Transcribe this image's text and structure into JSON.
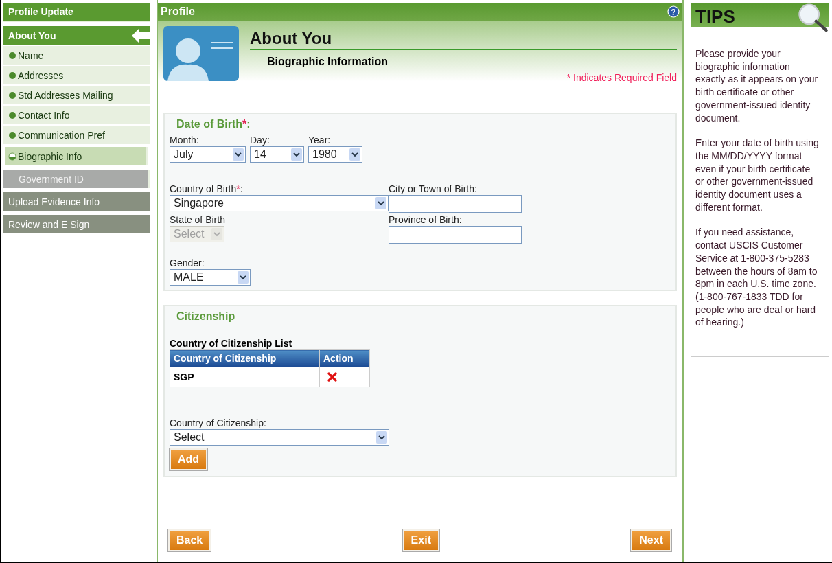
{
  "sidebar": {
    "title": "Profile Update",
    "sections": [
      {
        "label": "About You",
        "selected": true,
        "children": [
          {
            "label": "Name",
            "selected": false,
            "disabled": false
          },
          {
            "label": "Addresses",
            "selected": false,
            "disabled": false
          },
          {
            "label": "Std Addresses Mailing",
            "selected": false,
            "disabled": false
          },
          {
            "label": "Contact Info",
            "selected": false,
            "disabled": false
          },
          {
            "label": "Communication Pref",
            "selected": false,
            "disabled": false
          },
          {
            "label": "Biographic Info",
            "selected": true,
            "disabled": false
          },
          {
            "label": "Government ID",
            "selected": false,
            "disabled": true
          }
        ]
      },
      {
        "label": "Upload Evidence Info",
        "selected": false
      },
      {
        "label": "Review and E Sign",
        "selected": false
      }
    ]
  },
  "panel": {
    "title": "Profile",
    "help_glyph": "?",
    "heading": "About You",
    "subheading": "Biographic Information",
    "required_note": "* Indicates Required Field"
  },
  "date_of_birth": {
    "legend": "Date of Birth",
    "asterisk": "*",
    "colon": ":",
    "fields": [
      {
        "label": "Month:",
        "value": "July"
      },
      {
        "label": "Day:",
        "value": "14"
      },
      {
        "label": "Year:",
        "value": "1980"
      }
    ]
  },
  "place_fields": [
    {
      "label": "Country of Birth",
      "asterisk": "*",
      "colon": ":",
      "kind": "select",
      "value": "Singapore",
      "disabled": false
    },
    {
      "label": "City or Town of Birth:",
      "kind": "text",
      "disabled": false
    },
    {
      "label": "State of Birth",
      "kind": "select",
      "value": "Select",
      "disabled": true
    },
    {
      "label": "Province of Birth:",
      "kind": "text",
      "disabled": false
    },
    {
      "label": "Gender:",
      "kind": "select",
      "value": "MALE",
      "disabled": false
    }
  ],
  "citizenship": {
    "legend": "Citizenship",
    "list_title": "Country of Citizenship List",
    "columns": [
      "Country of Citizenship",
      "Action"
    ],
    "rows": [
      {
        "country": "SGP"
      }
    ],
    "field": {
      "label": "Country of Citizenship:",
      "value": "Select"
    },
    "add_button": "Add"
  },
  "footer_buttons": [
    "Back",
    "Exit",
    "Next"
  ],
  "tips": {
    "title": "TIPS",
    "paragraphs": [
      "Please provide your biographic information exactly as it appears on your birth certificate or other government-issued identity document.",
      "Enter your date of birth using the MM/DD/YYYY format even if your birth certificate or other government-issued identity document uses a different format.",
      "If you need assistance, contact USCIS Customer Service at 1-800-375-5283 between the hours of 8am to 8pm in each U.S. time zone.(1-800-767-1833 TDD for people who are deaf or hard of hearing.)"
    ]
  }
}
